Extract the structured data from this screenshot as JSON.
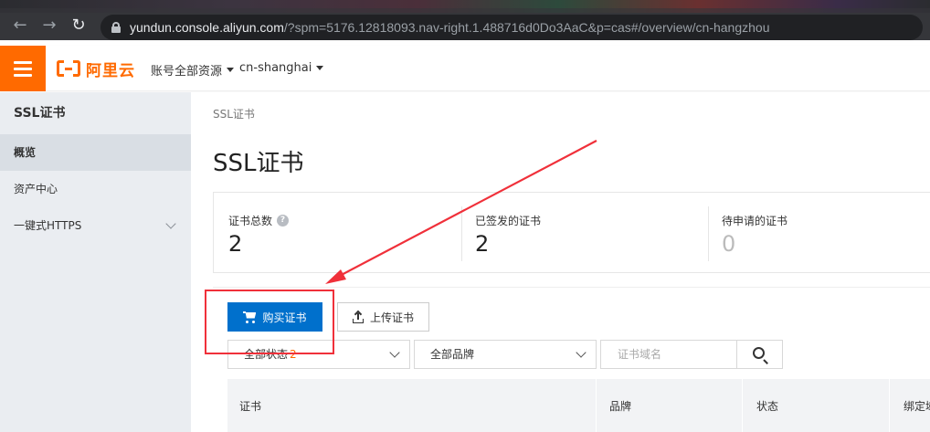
{
  "browser": {
    "url_host": "yundun.console.aliyun.com",
    "url_rest": "/?spm=5176.12818093.nav-right.1.488716d0Do3AaC&p=cas#/overview/cn-hangzhou"
  },
  "topbar": {
    "logo_text": "阿里云",
    "account_label": "账号全部资源",
    "region_label": "cn-shanghai"
  },
  "sidebar": {
    "title": "SSL证书",
    "items": [
      {
        "label": "概览",
        "active": true
      },
      {
        "label": "资产中心",
        "active": false
      },
      {
        "label": "一键式HTTPS",
        "active": false,
        "expandable": true
      }
    ]
  },
  "main": {
    "breadcrumb": "SSL证书",
    "title": "SSL证书",
    "stats": [
      {
        "label": "证书总数",
        "value": "2",
        "has_help": true
      },
      {
        "label": "已签发的证书",
        "value": "2"
      },
      {
        "label": "待申请的证书",
        "value": "0"
      }
    ],
    "buy_button": "购买证书",
    "upload_button": "上传证书",
    "filters": {
      "status_label": "全部状态",
      "status_count": "2",
      "brand_label": "全部品牌",
      "search_placeholder": "证书域名"
    },
    "table_headers": [
      "证书",
      "品牌",
      "状态",
      "绑定域"
    ]
  },
  "colors": {
    "brand_orange": "#ff6a00",
    "primary_blue": "#0070cc",
    "annotation_red": "#f0303a"
  }
}
